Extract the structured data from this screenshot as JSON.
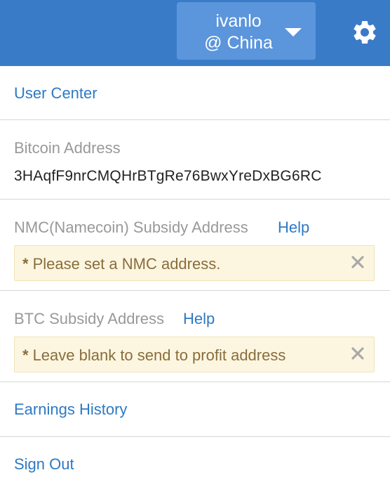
{
  "header": {
    "username": "ivanlo",
    "region": "@ China",
    "accent_color": "#3a7bc8",
    "settings_icon": "gear-icon",
    "dropdown_icon": "caret-down-icon"
  },
  "menu": {
    "user_center": "User Center",
    "bitcoin_address_label": "Bitcoin Address",
    "bitcoin_address_value": "3HAqfF9nrCMQHrBTgRe76BwxYreDxBG6RC",
    "nmc_label": "NMC(Namecoin) Subsidy Address",
    "nmc_help": "Help",
    "nmc_warning_star": "*",
    "nmc_warning": "Please set a NMC address.",
    "btc_subsidy_label": "BTC Subsidy Address",
    "btc_subsidy_help": "Help",
    "btc_subsidy_warning_star": "*",
    "btc_subsidy_warning": "Leave blank to send to profit address",
    "earnings_history": "Earnings History",
    "sign_out": "Sign Out"
  }
}
